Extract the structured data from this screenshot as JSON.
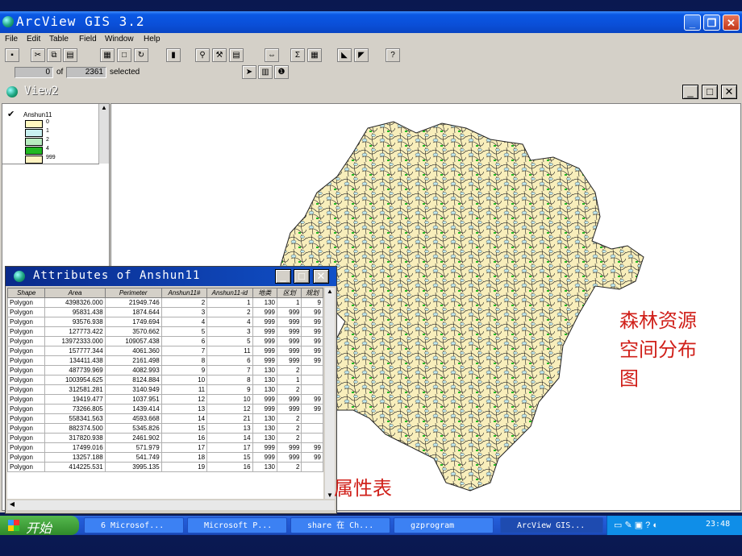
{
  "app": {
    "title": "ArcView GIS 3.2"
  },
  "menu": [
    "File",
    "Edit",
    "Table",
    "Field",
    "Window",
    "Help"
  ],
  "selection": {
    "count": "0",
    "of_label": "of",
    "total": "2361",
    "selected_label": "selected"
  },
  "view": {
    "title": "View2",
    "legend": {
      "theme": "Anshun11",
      "classes": [
        {
          "label": "0",
          "color": "#fff8c0"
        },
        {
          "label": "1",
          "color": "#c8f0f0"
        },
        {
          "label": "2",
          "color": "#b8ecc0"
        },
        {
          "label": "4",
          "color": "#22b822"
        },
        {
          "label": "999",
          "color": "#fff3c0"
        }
      ]
    }
  },
  "attributes": {
    "title": "Attributes of Anshun11",
    "columns": [
      "Shape",
      "Area",
      "Perimeter",
      "Anshun11#",
      "Anshun11-id",
      "地类",
      "区划",
      "规划"
    ],
    "rows": [
      [
        "Polygon",
        "4398326.000",
        "21949.746",
        "2",
        "1",
        "130",
        "1",
        "9"
      ],
      [
        "Polygon",
        "95831.438",
        "1874.644",
        "3",
        "2",
        "999",
        "999",
        "99"
      ],
      [
        "Polygon",
        "93576.938",
        "1749.694",
        "4",
        "4",
        "999",
        "999",
        "99"
      ],
      [
        "Polygon",
        "127773.422",
        "3570.662",
        "5",
        "3",
        "999",
        "999",
        "99"
      ],
      [
        "Polygon",
        "13972333.000",
        "109057.438",
        "6",
        "5",
        "999",
        "999",
        "99"
      ],
      [
        "Polygon",
        "157777.344",
        "4061.360",
        "7",
        "11",
        "999",
        "999",
        "99"
      ],
      [
        "Polygon",
        "134411.438",
        "2161.498",
        "8",
        "6",
        "999",
        "999",
        "99"
      ],
      [
        "Polygon",
        "487739.969",
        "4082.993",
        "9",
        "7",
        "130",
        "2",
        ""
      ],
      [
        "Polygon",
        "1003954.625",
        "8124.884",
        "10",
        "8",
        "130",
        "1",
        ""
      ],
      [
        "Polygon",
        "312581.281",
        "3140.949",
        "11",
        "9",
        "130",
        "2",
        ""
      ],
      [
        "Polygon",
        "19419.477",
        "1037.951",
        "12",
        "10",
        "999",
        "999",
        "99"
      ],
      [
        "Polygon",
        "73266.805",
        "1439.414",
        "13",
        "12",
        "999",
        "999",
        "99"
      ],
      [
        "Polygon",
        "558341.563",
        "4593.668",
        "14",
        "21",
        "130",
        "2",
        ""
      ],
      [
        "Polygon",
        "882374.500",
        "5345.826",
        "15",
        "13",
        "130",
        "2",
        ""
      ],
      [
        "Polygon",
        "317820.938",
        "2461.902",
        "16",
        "14",
        "130",
        "2",
        ""
      ],
      [
        "Polygon",
        "17499.016",
        "571.979",
        "17",
        "17",
        "999",
        "999",
        "99"
      ],
      [
        "Polygon",
        "13257.188",
        "541.749",
        "18",
        "15",
        "999",
        "999",
        "99"
      ],
      [
        "Polygon",
        "414225.531",
        "3995.135",
        "19",
        "16",
        "130",
        "2",
        ""
      ]
    ]
  },
  "captions": {
    "map": "森林资源空间分布图",
    "table": "属性表"
  },
  "taskbar": {
    "start": "开始",
    "tasks": [
      "6 Microsof...",
      "Microsoft P...",
      "share 在 Ch...",
      "gzprogram",
      "ArcView GIS..."
    ],
    "clock": "23:48"
  }
}
